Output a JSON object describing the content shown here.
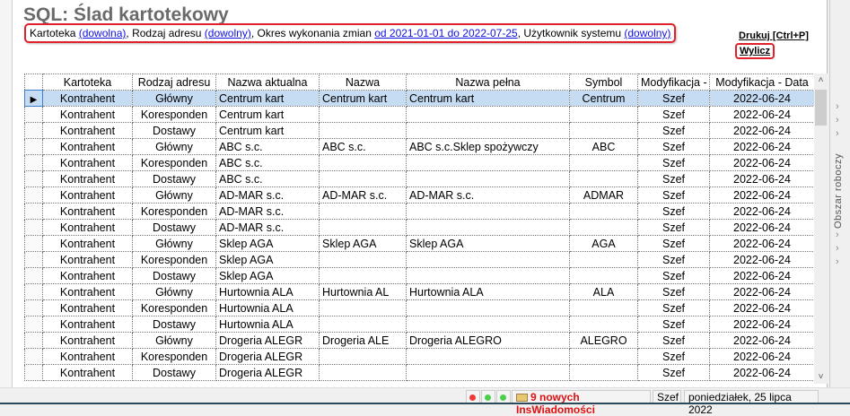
{
  "title": "SQL: Ślad kartotekowy",
  "params": {
    "kartoteka_label": "Kartoteka ",
    "kartoteka_value": "(dowolna)",
    "rodzaj_label": ", Rodzaj adresu ",
    "rodzaj_value": "(dowolny)",
    "okres_label": ", Okres wykonania zmian ",
    "okres_value": "od 2021-01-01 do 2022-07-25",
    "user_label": ", Użytkownik systemu ",
    "user_value": "(dowolny)"
  },
  "actions": {
    "print": "Drukuj [Ctrl+P]",
    "calc": "Wylicz"
  },
  "columns": [
    "Kartoteka",
    "Rodzaj adresu",
    "Nazwa aktualna",
    "Nazwa",
    "Nazwa pełna",
    "Symbol",
    "Modyfikacja -",
    "Modyfikacja - Data"
  ],
  "rows": [
    [
      "Kontrahent",
      "Główny",
      "Centrum kart",
      "Centrum kart",
      "Centrum kart",
      "Centrum",
      "Szef",
      "2022-06-24"
    ],
    [
      "Kontrahent",
      "Koresponden",
      "Centrum kart",
      "",
      "",
      "",
      "Szef",
      "2022-06-24"
    ],
    [
      "Kontrahent",
      "Dostawy",
      "Centrum kart",
      "",
      "",
      "",
      "Szef",
      "2022-06-24"
    ],
    [
      "Kontrahent",
      "Główny",
      "ABC s.c.",
      "ABC s.c.",
      "ABC s.c.Sklep spożywczy",
      "ABC",
      "Szef",
      "2022-06-24"
    ],
    [
      "Kontrahent",
      "Koresponden",
      "ABC s.c.",
      "",
      "",
      "",
      "Szef",
      "2022-06-24"
    ],
    [
      "Kontrahent",
      "Dostawy",
      "ABC s.c.",
      "",
      "",
      "",
      "Szef",
      "2022-06-24"
    ],
    [
      "Kontrahent",
      "Główny",
      "AD-MAR s.c.",
      "AD-MAR s.c.",
      "AD-MAR s.c.",
      "ADMAR",
      "Szef",
      "2022-06-24"
    ],
    [
      "Kontrahent",
      "Koresponden",
      "AD-MAR s.c.",
      "",
      "",
      "",
      "Szef",
      "2022-06-24"
    ],
    [
      "Kontrahent",
      "Dostawy",
      "AD-MAR s.c.",
      "",
      "",
      "",
      "Szef",
      "2022-06-24"
    ],
    [
      "Kontrahent",
      "Główny",
      "Sklep AGA",
      "Sklep AGA",
      "Sklep AGA",
      "AGA",
      "Szef",
      "2022-06-24"
    ],
    [
      "Kontrahent",
      "Koresponden",
      "Sklep AGA",
      "",
      "",
      "",
      "Szef",
      "2022-06-24"
    ],
    [
      "Kontrahent",
      "Dostawy",
      "Sklep AGA",
      "",
      "",
      "",
      "Szef",
      "2022-06-24"
    ],
    [
      "Kontrahent",
      "Główny",
      "Hurtownia ALA",
      "Hurtownia AL",
      "Hurtownia ALA",
      "ALA",
      "Szef",
      "2022-06-24"
    ],
    [
      "Kontrahent",
      "Koresponden",
      "Hurtownia ALA",
      "",
      "",
      "",
      "Szef",
      "2022-06-24"
    ],
    [
      "Kontrahent",
      "Dostawy",
      "Hurtownia ALA",
      "",
      "",
      "",
      "Szef",
      "2022-06-24"
    ],
    [
      "Kontrahent",
      "Główny",
      "Drogeria ALEGR",
      "Drogeria ALE",
      "Drogeria ALEGRO",
      "ALEGRO",
      "Szef",
      "2022-06-24"
    ],
    [
      "Kontrahent",
      "Koresponden",
      "Drogeria ALEGR",
      "",
      "",
      "",
      "Szef",
      "2022-06-24"
    ],
    [
      "Kontrahent",
      "Dostawy",
      "Drogeria ALEGR",
      "",
      "",
      "",
      "Szef",
      "2022-06-24"
    ]
  ],
  "right_panel": "Obszar roboczy",
  "status": {
    "messages": "9 nowych InsWiadomości",
    "user": "Szef",
    "date": "poniedziałek, 25 lipca 2022"
  }
}
